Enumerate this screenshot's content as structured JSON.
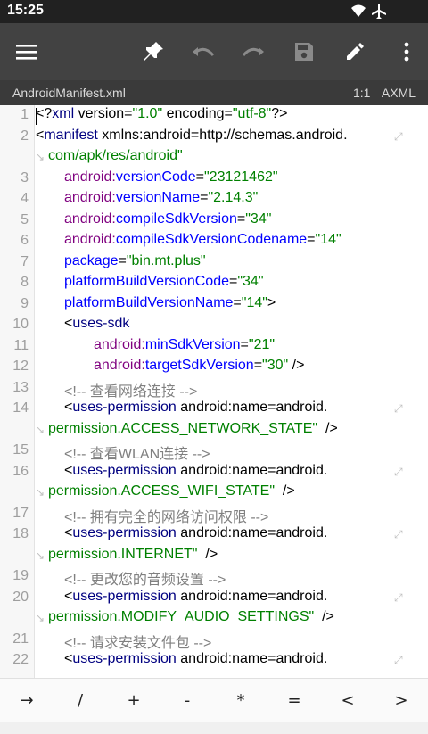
{
  "status": {
    "time": "15:25"
  },
  "toolbar": {
    "menu_icon": "menu-icon",
    "pin_icon": "pin-icon",
    "undo_icon": "undo-icon",
    "redo_icon": "redo-icon",
    "save_icon": "save-icon",
    "edit_icon": "pencil-icon",
    "more_icon": "more-vert-icon"
  },
  "file": {
    "name": "AndroidManifest.xml",
    "position": "1:1",
    "type": "AXML"
  },
  "lines": [
    {
      "num": "1",
      "code": "<?xml version=\"1.0\" encoding=\"utf-8\"?>"
    },
    {
      "num": "2",
      "code": "<manifest xmlns:android=\"http://schemas.android."
    },
    {
      "num": "",
      "code": "com/apk/res/android\""
    },
    {
      "num": "3",
      "code": "android:versionCode=\"23121462\""
    },
    {
      "num": "4",
      "code": "android:versionName=\"2.14.3\""
    },
    {
      "num": "5",
      "code": "android:compileSdkVersion=\"34\""
    },
    {
      "num": "6",
      "code": "android:compileSdkVersionCodename=\"14\""
    },
    {
      "num": "7",
      "code": "package=\"bin.mt.plus\""
    },
    {
      "num": "8",
      "code": "platformBuildVersionCode=\"34\""
    },
    {
      "num": "9",
      "code": "platformBuildVersionName=\"14\">"
    },
    {
      "num": "10",
      "code": "<uses-sdk"
    },
    {
      "num": "11",
      "code": "android:minSdkVersion=\"21\""
    },
    {
      "num": "12",
      "code": "android:targetSdkVersion=\"30\" />"
    },
    {
      "num": "13",
      "code": "<!-- 查看网络连接 -->"
    },
    {
      "num": "14",
      "code": "<uses-permission android:name=\"android."
    },
    {
      "num": "",
      "code": "permission.ACCESS_NETWORK_STATE\" />"
    },
    {
      "num": "15",
      "code": "<!-- 查看WLAN连接 -->"
    },
    {
      "num": "16",
      "code": "<uses-permission android:name=\"android."
    },
    {
      "num": "",
      "code": "permission.ACCESS_WIFI_STATE\" />"
    },
    {
      "num": "17",
      "code": "<!-- 拥有完全的网络访问权限 -->"
    },
    {
      "num": "18",
      "code": "<uses-permission android:name=\"android."
    },
    {
      "num": "",
      "code": "permission.INTERNET\" />"
    },
    {
      "num": "19",
      "code": "<!-- 更改您的音频设置 -->"
    },
    {
      "num": "20",
      "code": "<uses-permission android:name=\"android."
    },
    {
      "num": "",
      "code": "permission.MODIFY_AUDIO_SETTINGS\" />"
    },
    {
      "num": "21",
      "code": "<!-- 请求安装文件包 -->"
    },
    {
      "num": "22",
      "code": "<uses-permission android:name=\"android."
    }
  ],
  "symbols": [
    "→",
    "/",
    "+",
    "-",
    "*",
    "=",
    "<",
    ">"
  ]
}
